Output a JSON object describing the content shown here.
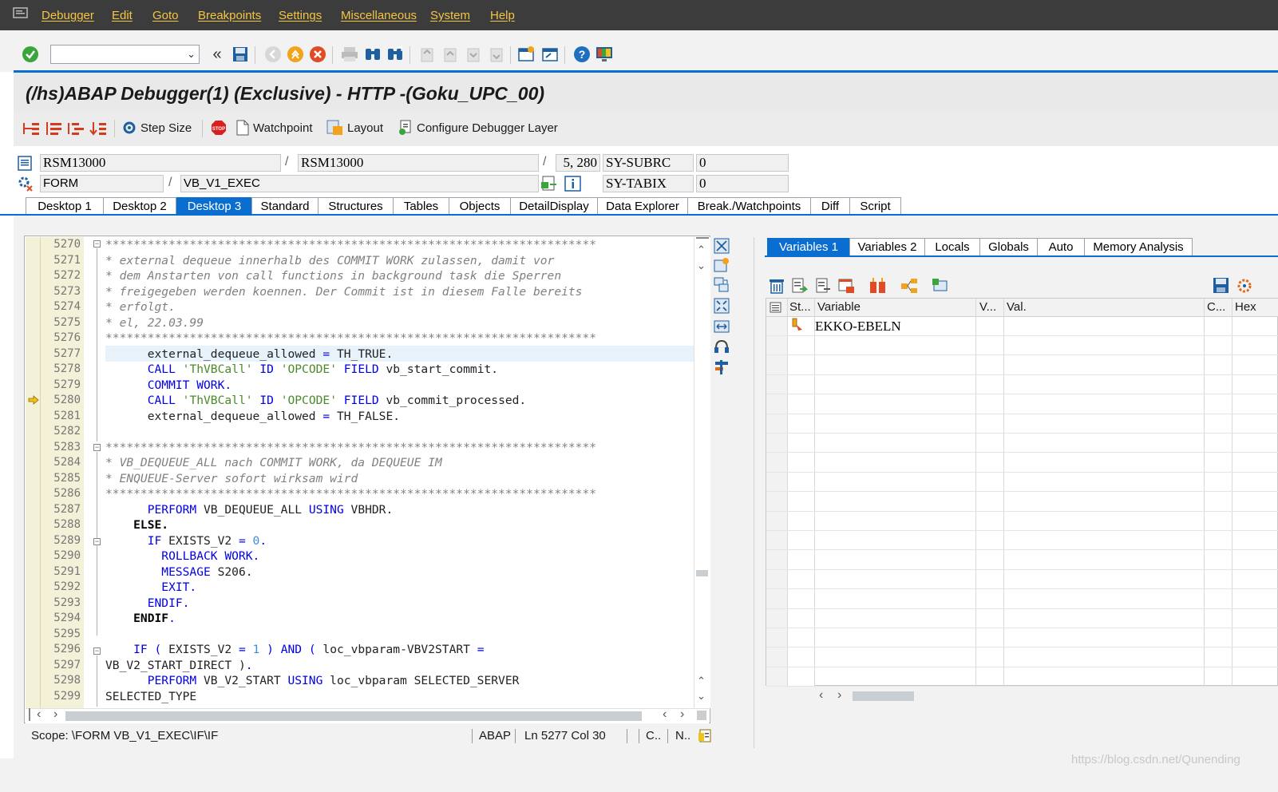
{
  "menu": [
    "Debugger",
    "Edit",
    "Goto",
    "Breakpoints",
    "Settings",
    "Miscellaneous",
    "System",
    "Help"
  ],
  "window_title": "(/hs)ABAP Debugger(1)  (Exclusive) - HTTP -(Goku_UPC_00)",
  "app_toolbar": {
    "step_size": "Step Size",
    "watchpoint": "Watchpoint",
    "layout": "Layout",
    "configure": "Configure Debugger Layer"
  },
  "info": {
    "program": "RSM13000",
    "include": "RSM13000",
    "line": "5, 280",
    "sy_subrc_label": "SY-SUBRC",
    "sy_subrc_value": "0",
    "event_type": "FORM",
    "event_name": "VB_V1_EXEC",
    "sy_tabix_label": "SY-TABIX",
    "sy_tabix_value": "0"
  },
  "tabs": [
    "Desktop 1",
    "Desktop 2",
    "Desktop 3",
    "Standard",
    "Structures",
    "Tables",
    "Objects",
    "DetailDisplay",
    "Data Explorer",
    "Break./Watchpoints",
    "Diff",
    "Script"
  ],
  "active_tab": "Desktop 3",
  "line_numbers": [
    "5270",
    "5271",
    "5272",
    "5273",
    "5274",
    "5275",
    "5276",
    "5277",
    "5278",
    "5279",
    "5280",
    "5281",
    "5282",
    "5283",
    "5284",
    "5285",
    "5286",
    "5287",
    "5288",
    "5289",
    "5290",
    "5291",
    "5292",
    "5293",
    "5294",
    "5295",
    "5296",
    "5297",
    "5298",
    "5299"
  ],
  "code": {
    "l5270": "**********************************************************************",
    "l5271": "* external dequeue innerhalb des COMMIT WORK zulassen, damit vor",
    "l5272": "* dem Anstarten von call functions in background task die Sperren",
    "l5273": "* freigegeben werden koennen. Der Commit ist in diesem Falle bereits",
    "l5274": "* erfolgt.",
    "l5275": "* el, 22.03.99",
    "l5276": "**********************************************************************",
    "l5277_a": "      external_dequeue_allowed ",
    "l5277_b": "=",
    "l5277_c": " TH_TRUE.",
    "l5278_kw": "      CALL ",
    "l5278_str": "'ThVBCall'",
    "l5278_kw2": " ID ",
    "l5278_str2": "'OPCODE'",
    "l5278_kw3": " FIELD ",
    "l5278_rest": "vb_start_commit.",
    "l5279": "      COMMIT WORK.",
    "l5280_kw": "      CALL ",
    "l5280_str": "'ThVBCall'",
    "l5280_kw2": " ID ",
    "l5280_str2": "'OPCODE'",
    "l5280_kw3": " FIELD ",
    "l5280_rest": "vb_commit_processed.",
    "l5281_a": "      external_dequeue_allowed ",
    "l5281_b": "=",
    "l5281_c": " TH_FALSE.",
    "l5283": "**********************************************************************",
    "l5284": "* VB_DEQUEUE_ALL nach COMMIT WORK, da DEQUEUE IM",
    "l5285": "* ENQUEUE-Server sofort wirksam wird",
    "l5286": "**********************************************************************",
    "l5287_kw": "      PERFORM ",
    "l5287_a": "VB_DEQUEUE_ALL ",
    "l5287_kw2": "USING",
    "l5287_b": " VBHDR.",
    "l5288": "    ELSE",
    "l5288_dot": ".",
    "l5289_kw": "      IF ",
    "l5289_a": "EXISTS_V2 ",
    "l5289_op": "=",
    "l5289_num": " 0",
    "l5289_dot": ".",
    "l5290": "        ROLLBACK WORK.",
    "l5291_kw": "        MESSAGE ",
    "l5291_a": "S206.",
    "l5292": "        EXIT.",
    "l5293": "      ENDIF.",
    "l5294": "    ENDIF",
    "l5294_dot": ".",
    "l5296_kw": "    IF ",
    "l5296_p1": "( ",
    "l5296_a": "EXISTS_V2 ",
    "l5296_op": "=",
    "l5296_num": " 1",
    "l5296_p2": " ) ",
    "l5296_and": "AND",
    "l5296_p3": " ( ",
    "l5296_b": "loc_vbparam-VBV2START ",
    "l5296_op2": "=",
    "l5297_a": "VB_V2_START_DIRECT ",
    "l5297_p": ")",
    "l5297_dot": ".",
    "l5298_kw": "      PERFORM ",
    "l5298_a": "VB_V2_START ",
    "l5298_kw2": "USING",
    "l5298_b": " loc_vbparam SELECTED_SERVER",
    "l5299": "SELECTED_TYPE"
  },
  "status": {
    "scope": "Scope: \\FORM VB_V1_EXEC\\IF\\IF",
    "lang": "ABAP",
    "position": "Ln 5277 Col  30",
    "c": "C..",
    "n": "N.."
  },
  "variable_tabs": [
    "Variables 1",
    "Variables 2",
    "Locals",
    "Globals",
    "Auto",
    "Memory Analysis"
  ],
  "active_variable_tab": "Variables 1",
  "grid": {
    "headers": [
      "St...",
      "Variable",
      "V...",
      "Val.",
      "C...",
      "Hex"
    ],
    "rows": [
      {
        "variable": "EKKO-EBELN"
      }
    ]
  },
  "watermark": "https://blog.csdn.net/Qunending",
  "colors": {
    "accent": "#0a6ed1",
    "menu_bg": "#3c3c3c",
    "menu_text": "#f4c542"
  }
}
